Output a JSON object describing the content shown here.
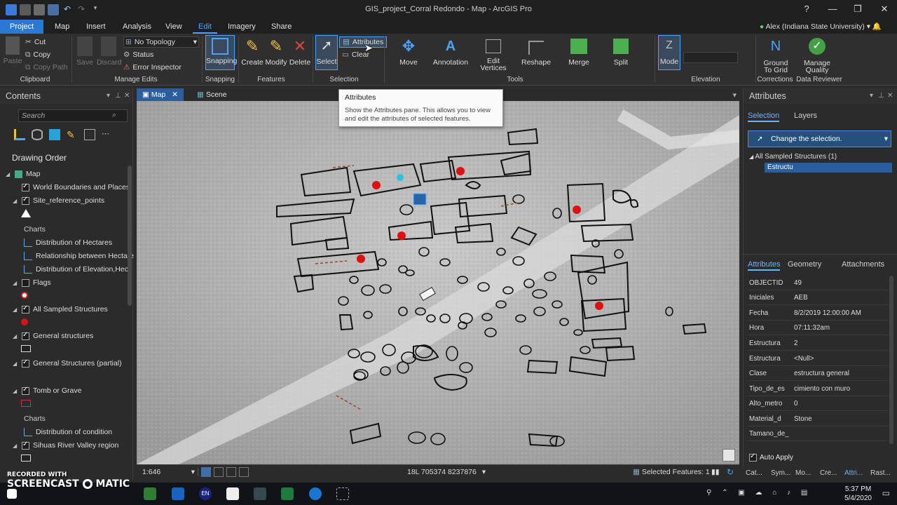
{
  "window": {
    "title": "GIS_project_Corral Redondo - Map - ArcGIS Pro",
    "help": "?",
    "minimize": "—",
    "restore": "❐",
    "close": "✕"
  },
  "ribbon_tabs": [
    "Project",
    "Map",
    "Insert",
    "Analysis",
    "View",
    "Edit",
    "Imagery",
    "Share"
  ],
  "user": "Alex (Indiana State University)",
  "ribbon": {
    "clipboard": {
      "paste": "Paste",
      "cut": "Cut",
      "copy": "Copy",
      "copy_path": "Copy Path",
      "label": "Clipboard"
    },
    "manage_edits": {
      "save": "Save",
      "discard": "Discard",
      "topology": "No Topology",
      "status": "Status",
      "error_inspector": "Error Inspector",
      "label": "Manage Edits"
    },
    "snapping": {
      "snapping": "Snapping",
      "label": "Snapping"
    },
    "features": {
      "create": "Create",
      "modify": "Modify",
      "delete": "Delete",
      "label": "Features"
    },
    "selection": {
      "select": "Select",
      "attributes": "Attributes",
      "clear": "Clear",
      "label": "Selection"
    },
    "tools": {
      "move": "Move",
      "annotation": "Annotation",
      "edit_vertices": "Edit Vertices",
      "reshape": "Reshape",
      "merge": "Merge",
      "split": "Split",
      "label": "Tools"
    },
    "elevation": {
      "mode": "Mode",
      "label": "Elevation"
    },
    "corrections": {
      "ground_to_grid": "Ground To Grid",
      "label": "Corrections"
    },
    "data_reviewer": {
      "manage_quality": "Manage Quality",
      "label": "Data Reviewer"
    }
  },
  "contents": {
    "title": "Contents",
    "search_placeholder": "Search",
    "drawing_order": "Drawing Order",
    "items": {
      "map": "Map",
      "world_boundaries": "World Boundaries and Places",
      "site_ref": "Site_reference_points",
      "charts1": "Charts",
      "chart_hectares": "Distribution of Hectares",
      "chart_relationship": "Relationship between Hectare",
      "chart_elevation": "Distribution of Elevation,Hect",
      "flags": "Flags",
      "all_sampled": "All Sampled Structures",
      "general_structures": "General structures",
      "general_partial": "General Structures (partial)",
      "tomb": "Tomb or Grave",
      "charts2": "Charts",
      "chart_condition": "Distribution of condition",
      "sihuas": "Sihuas River Valley region"
    }
  },
  "view_tabs": {
    "map": "Map",
    "scene": "Scene"
  },
  "tooltip": {
    "title": "Attributes",
    "body": "Show the Attributes pane. This allows you to view and edit the attributes of selected features."
  },
  "statusbar": {
    "scale": "1:646",
    "coords": "18L 705374 8237876",
    "selected": "Selected Features: 1"
  },
  "attributes_pane": {
    "title": "Attributes",
    "tab_selection": "Selection",
    "tab_layers": "Layers",
    "change_selection": "Change the selection.",
    "tree_layer": "All Sampled Structures (1)",
    "tree_feature": "Estructu",
    "tab_attributes": "Attributes",
    "tab_geometry": "Geometry",
    "tab_attachments": "Attachments",
    "rows": [
      {
        "k": "OBJECTID",
        "v": "49"
      },
      {
        "k": "Iniciales",
        "v": "AEB"
      },
      {
        "k": "Fecha",
        "v": "8/2/2019 12:00:00 AM"
      },
      {
        "k": "Hora",
        "v": "07:11:32am"
      },
      {
        "k": "Estructura",
        "v": "2"
      },
      {
        "k": "Estructura",
        "v": "<Null>"
      },
      {
        "k": "Clase",
        "v": "estructura general"
      },
      {
        "k": "Tipo_de_es",
        "v": "cimiento con muro"
      },
      {
        "k": "Alto_metro",
        "v": "0"
      },
      {
        "k": "Material_d",
        "v": "Stone"
      },
      {
        "k": "Tamano_de_",
        "v": ""
      }
    ],
    "auto_apply": "Auto Apply"
  },
  "bottom_tabs": [
    "Cat...",
    "Sym...",
    "Mo...",
    "Cre...",
    "Attri...",
    "Rast..."
  ],
  "taskbar": {
    "time": "5:37 PM",
    "date": "5/4/2020",
    "lang": "EN"
  },
  "watermark": {
    "line1": "RECORDED WITH",
    "line2": "SCREENCAST",
    "line3": "MATIC"
  },
  "colors": {
    "accent": "#2a7ad5",
    "feature_point": "#e01010",
    "selection": "#29c4e0"
  }
}
